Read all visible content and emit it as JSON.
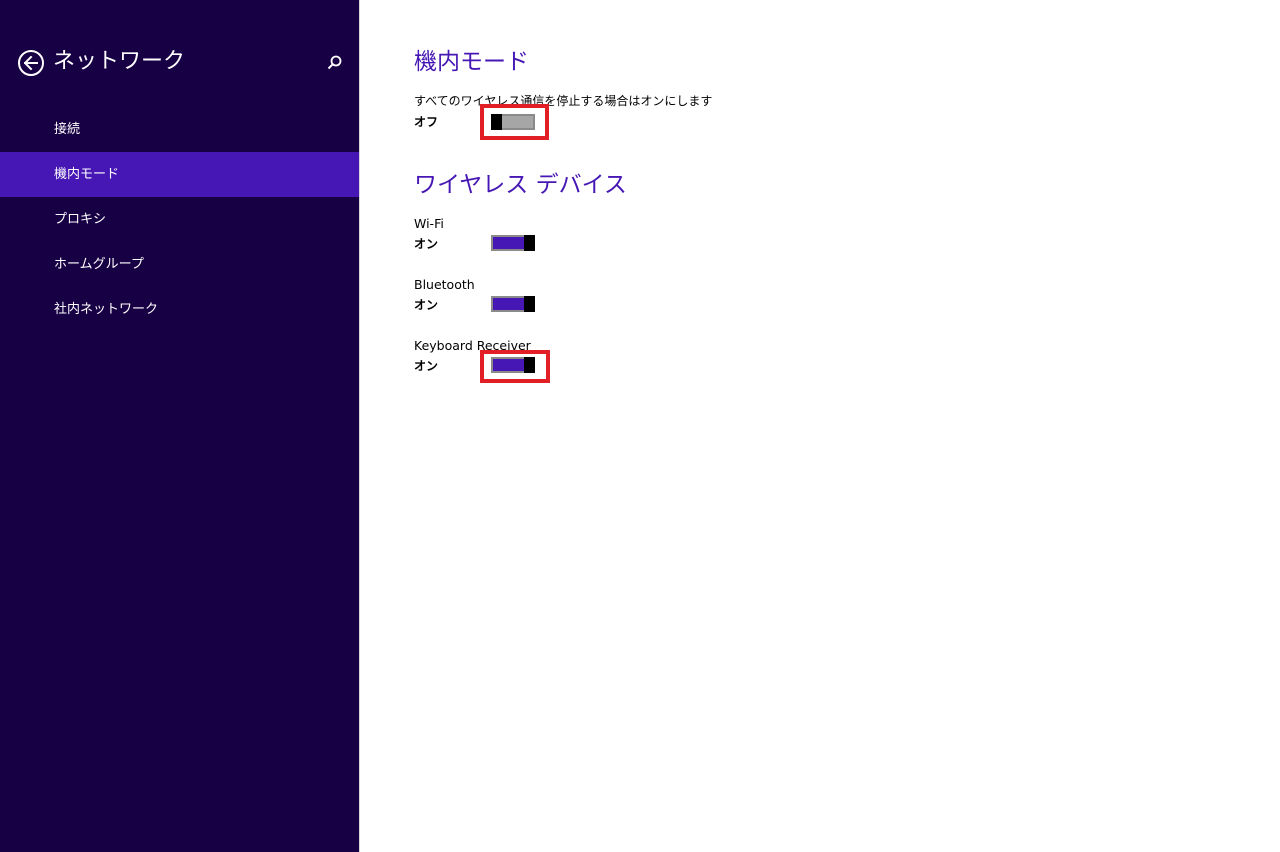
{
  "sidebar": {
    "title": "ネットワーク",
    "back_icon": "back-arrow-icon",
    "search_icon": "search-icon",
    "background_color": "#180044",
    "selected_color": "#4617b4",
    "items": [
      {
        "label": "接続"
      },
      {
        "label": "機内モード",
        "selected": true
      },
      {
        "label": "プロキシ"
      },
      {
        "label": "ホームグループ"
      },
      {
        "label": "社内ネットワーク"
      }
    ]
  },
  "main": {
    "airplane_mode": {
      "title": "機内モード",
      "description": "すべてのワイヤレス通信を停止する場合はオンにします",
      "state_label": "オフ",
      "on": false
    },
    "wireless_devices": {
      "title": "ワイヤレス デバイス",
      "devices": [
        {
          "name": "Wi-Fi",
          "state_label": "オン",
          "on": true
        },
        {
          "name": "Bluetooth",
          "state_label": "オン",
          "on": true
        },
        {
          "name": "Keyboard Receiver",
          "state_label": "オン",
          "on": true
        }
      ]
    },
    "accent_color": "#4617b4",
    "highlight_color": "#e21f26"
  }
}
